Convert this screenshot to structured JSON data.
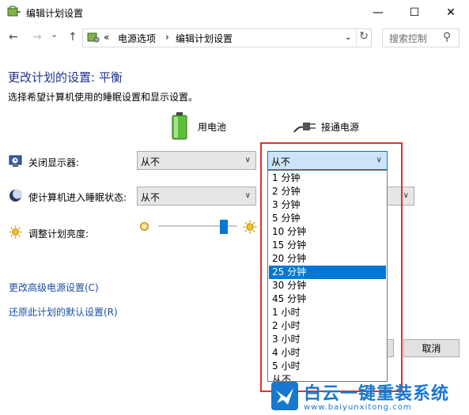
{
  "window": {
    "title": "编辑计划设置",
    "minimize_symbol": "—",
    "maximize_symbol": "☐",
    "close_symbol": "✕"
  },
  "nav": {
    "back_icon": "←",
    "forward_icon": "→",
    "dropdown_icon": "⌄",
    "up_icon": "↑",
    "path_prefix": "«",
    "breadcrumb": [
      "电源选项",
      "编辑计划设置"
    ],
    "path_sep": "›",
    "refresh_icon": "↻",
    "search_placeholder": "搜索控制",
    "search_icon": "⚲"
  },
  "page": {
    "heading": "更改计划的设置: 平衡",
    "subtext": "选择希望计算机使用的睡眠设置和显示设置。"
  },
  "columns": {
    "battery": "用电池",
    "plugged": "接通电源"
  },
  "rows": {
    "display_off": {
      "label": "关闭显示器:",
      "battery_value": "从不",
      "plugged_value": "从不"
    },
    "sleep": {
      "label": "使计算机进入睡眠状态:",
      "battery_value": "从不"
    },
    "brightness": {
      "label": "调整计划亮度:",
      "level": 0.85
    }
  },
  "chevron": "∨",
  "dropdown_options": [
    "1 分钟",
    "2 分钟",
    "3 分钟",
    "5 分钟",
    "10 分钟",
    "15 分钟",
    "20 分钟",
    "25 分钟",
    "30 分钟",
    "45 分钟",
    "1 小时",
    "2 小时",
    "3 小时",
    "4 小时",
    "5 小时",
    "从不"
  ],
  "dropdown_selected": "25 分钟",
  "links": {
    "advanced": "更改高级电源设置(C)",
    "restore": "还原此计划的默认设置(R)"
  },
  "buttons": {
    "cancel": "取消"
  },
  "watermark": {
    "text": "白云一键重装系统",
    "url": "www.baiyunxitong.com"
  },
  "colors": {
    "accent": "#0078d7",
    "heading": "#1e3287",
    "link": "#1a4fa5",
    "highlight_box": "#e03030"
  }
}
